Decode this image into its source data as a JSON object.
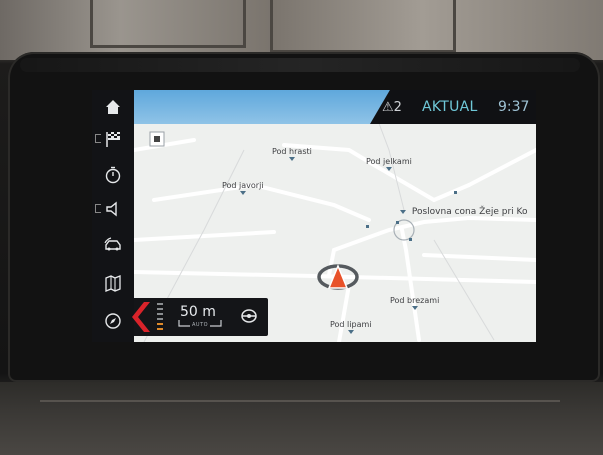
{
  "status": {
    "alert_count": "⚠2",
    "mode": "AKTUAL",
    "time": "9:37"
  },
  "sidebar": {
    "items": [
      {
        "name": "home-icon"
      },
      {
        "name": "destination-flag-icon"
      },
      {
        "name": "stopwatch-icon"
      },
      {
        "name": "speaker-icon"
      },
      {
        "name": "car-traffic-icon"
      },
      {
        "name": "map-book-icon"
      },
      {
        "name": "compass-icon"
      }
    ]
  },
  "map": {
    "places": [
      {
        "name": "Pod hrasti"
      },
      {
        "name": "Pod jelkami"
      },
      {
        "name": "Pod javorji"
      },
      {
        "name": "Poslovna cona Žeje pri Ko"
      },
      {
        "name": "Pod brezami"
      },
      {
        "name": "Pod lipami"
      }
    ]
  },
  "guidance": {
    "distance": "50 m",
    "scale_mode": "AUTO"
  },
  "colors": {
    "accent": "#6fc8d8",
    "turn_arrow": "#d9232a",
    "position_marker": "#e8522a"
  }
}
